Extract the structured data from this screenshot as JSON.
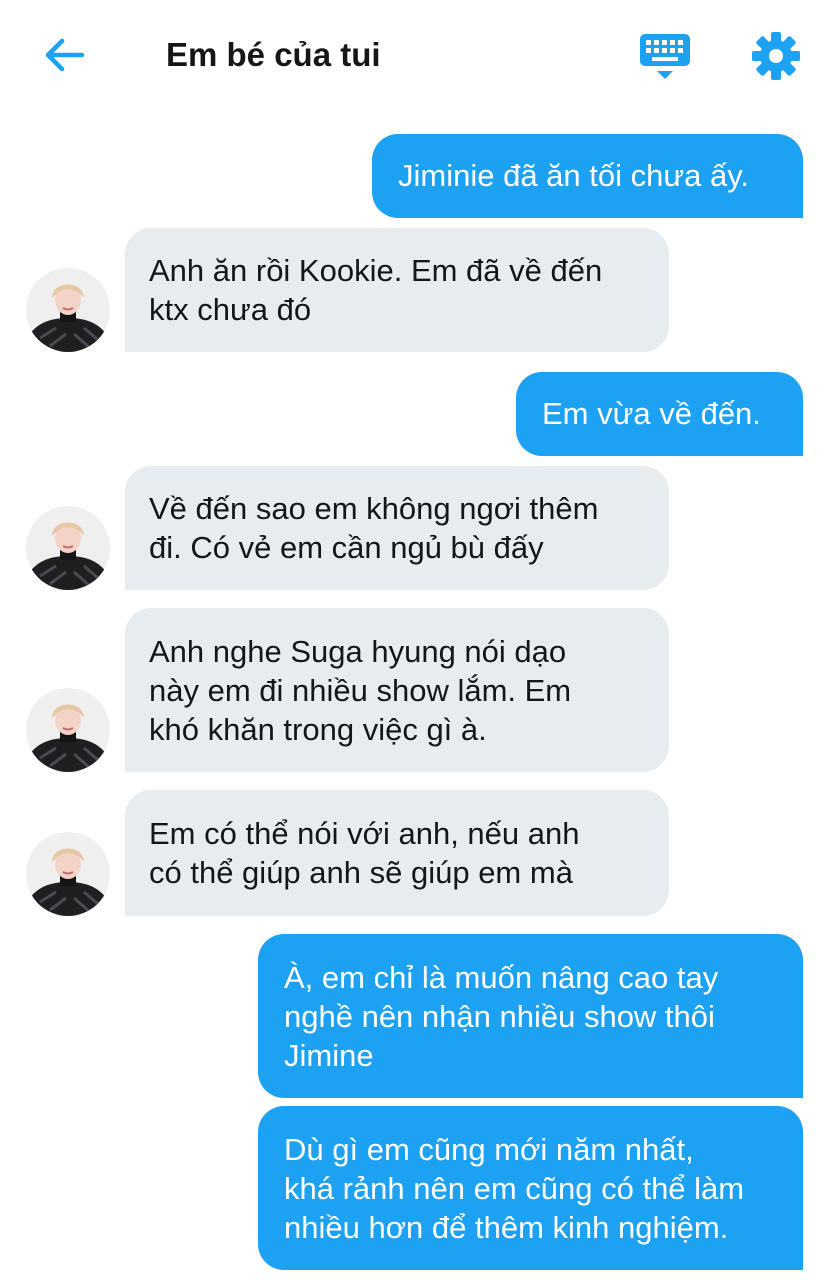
{
  "header": {
    "title": "Em bé của tui",
    "back_icon": "arrow-left-icon",
    "keyboard_icon": "keyboard-icon",
    "settings_icon": "gear-icon",
    "accent_color": "#1da1f2"
  },
  "colors": {
    "outgoing_bubble": "#1da1f2",
    "incoming_bubble": "#e6ecf0",
    "text_dark": "#14171a"
  },
  "messages": [
    {
      "direction": "outgoing",
      "text": "Jiminie đã ăn tối chưa ấy."
    },
    {
      "direction": "incoming",
      "text": "Anh ăn rồi Kookie. Em đã về đến\nktx chưa đó"
    },
    {
      "direction": "outgoing",
      "text": "Em vừa về đến."
    },
    {
      "direction": "incoming",
      "text": "Về đến sao em không ngơi thêm\nđi. Có vẻ em cần ngủ bù đấy"
    },
    {
      "direction": "incoming",
      "text": "Anh nghe Suga hyung nói dạo\nnày em đi nhiều show lắm. Em\nkhó khăn trong việc gì à."
    },
    {
      "direction": "incoming",
      "text": "Em có thể nói với anh, nếu anh\ncó thể giúp anh sẽ giúp em mà"
    },
    {
      "direction": "outgoing",
      "text": "À, em chỉ là muốn nâng cao tay\nnghề nên nhận nhiều show thôi\nJimine"
    },
    {
      "direction": "outgoing",
      "text": "Dù gì em cũng mới năm nhất,\nkhá rảnh nên em cũng có thể làm\nnhiều hơn để thêm kinh nghiệm."
    }
  ]
}
